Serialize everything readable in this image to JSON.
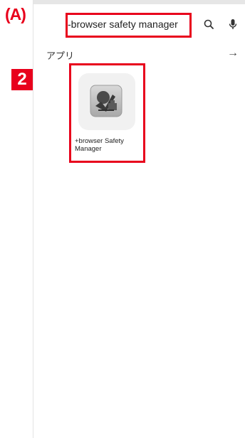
{
  "annotations": {
    "label_a": "(A)",
    "badge_number": "2"
  },
  "search": {
    "query": "-browser safety manager",
    "search_icon": "search-icon",
    "mic_icon": "mic-icon"
  },
  "section": {
    "title": "アプリ",
    "arrow_icon": "arrow-right-icon"
  },
  "app": {
    "name": "+browser Safety Manager",
    "icon": "browser-safety-manager-app-icon"
  },
  "colors": {
    "annotation_red": "#e8001c",
    "status_strip": "#e6e6e6"
  }
}
